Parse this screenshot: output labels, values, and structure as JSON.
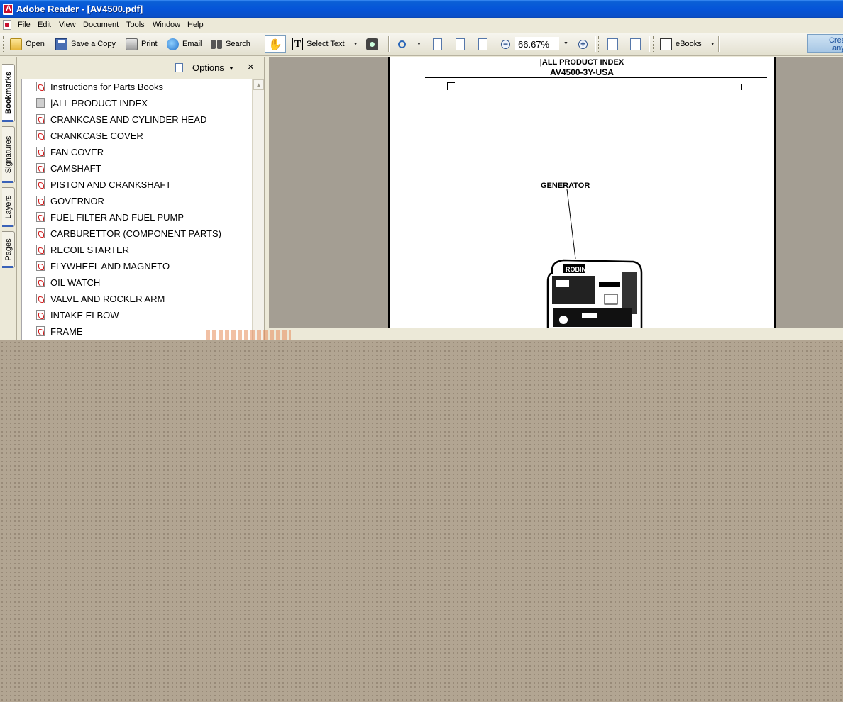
{
  "window": {
    "title": "Adobe Reader - [AV4500.pdf]"
  },
  "menu": [
    "File",
    "Edit",
    "View",
    "Document",
    "Tools",
    "Window",
    "Help"
  ],
  "toolbar": {
    "open": "Open",
    "save_copy": "Save a Copy",
    "print": "Print",
    "email": "Email",
    "search": "Search",
    "select_text": "Select Text",
    "zoom_value": "66.67%",
    "ebooks": "eBooks",
    "create_line1": "Crea",
    "create_line2": "any"
  },
  "nav_tabs": [
    "Bookmarks",
    "Signatures",
    "Layers",
    "Pages"
  ],
  "bookmarks_panel": {
    "options_label": "Options",
    "close": "×",
    "items": [
      "Instructions for Parts Books",
      "|ALL PRODUCT INDEX",
      "CRANKCASE AND CYLINDER HEAD",
      "CRANKCASE COVER",
      "FAN COVER",
      "CAMSHAFT",
      "PISTON AND CRANKSHAFT",
      "GOVERNOR",
      "FUEL FILTER AND FUEL PUMP",
      "CARBURETTOR (COMPONENT PARTS)",
      "RECOIL STARTER",
      "FLYWHEEL AND MAGNETO",
      "OIL WATCH",
      "VALVE AND ROCKER ARM",
      "INTAKE ELBOW",
      "FRAME"
    ]
  },
  "document": {
    "header_line1": "|ALL PRODUCT INDEX",
    "header_line2": "AV4500-3Y-USA",
    "callout": "GENERATOR",
    "brand_on_unit": "ROBIN"
  },
  "colors": {
    "titlebar": "#0554d8",
    "chrome": "#ece9d8",
    "desktop": "#b2a592"
  }
}
